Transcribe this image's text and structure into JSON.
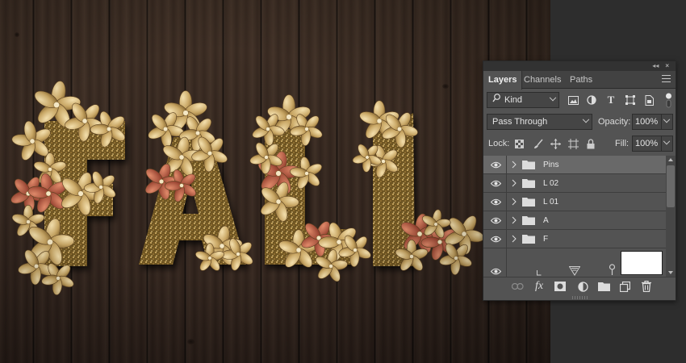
{
  "panel": {
    "collapse_icon": "double-chevron-left-icon",
    "close_icon": "close-icon",
    "tabs": [
      {
        "label": "Layers",
        "active": true
      },
      {
        "label": "Channels",
        "active": false
      },
      {
        "label": "Paths",
        "active": false
      }
    ],
    "filter": {
      "kind_label": "Kind",
      "icons": [
        "search-icon",
        "pixel-filter-icon",
        "adjustment-filter-icon",
        "type-filter-icon",
        "shape-filter-icon",
        "smart-object-filter-icon",
        "filter-toggle-icon"
      ]
    },
    "blend_mode": "Pass Through",
    "opacity_label": "Opacity:",
    "opacity_value": "100%",
    "lock_label": "Lock:",
    "lock_icons": [
      "lock-transparent-icon",
      "lock-image-icon",
      "lock-position-icon",
      "lock-artboard-icon",
      "lock-all-icon"
    ],
    "fill_label": "Fill:",
    "fill_value": "100%",
    "layers": [
      {
        "name": "Pins",
        "type": "group",
        "visible": true,
        "selected": true
      },
      {
        "name": "L 02",
        "type": "group",
        "visible": true,
        "selected": false
      },
      {
        "name": "L 01",
        "type": "group",
        "visible": true,
        "selected": false
      },
      {
        "name": "A",
        "type": "group",
        "visible": true,
        "selected": false
      },
      {
        "name": "F",
        "type": "group",
        "visible": true,
        "selected": false
      },
      {
        "name": "",
        "type": "fill-layer",
        "visible": true,
        "selected": false
      }
    ],
    "footer_icons": [
      "link-layers-icon",
      "fx-icon",
      "add-mask-icon",
      "adjustment-layer-icon",
      "new-group-icon",
      "new-layer-icon",
      "delete-icon"
    ]
  },
  "colors": {
    "panel_bg": "#535353",
    "selected_row": "#696969",
    "wood": "#3a2b22",
    "gold": "#c9a765",
    "leaf_red": "#b5503a"
  }
}
